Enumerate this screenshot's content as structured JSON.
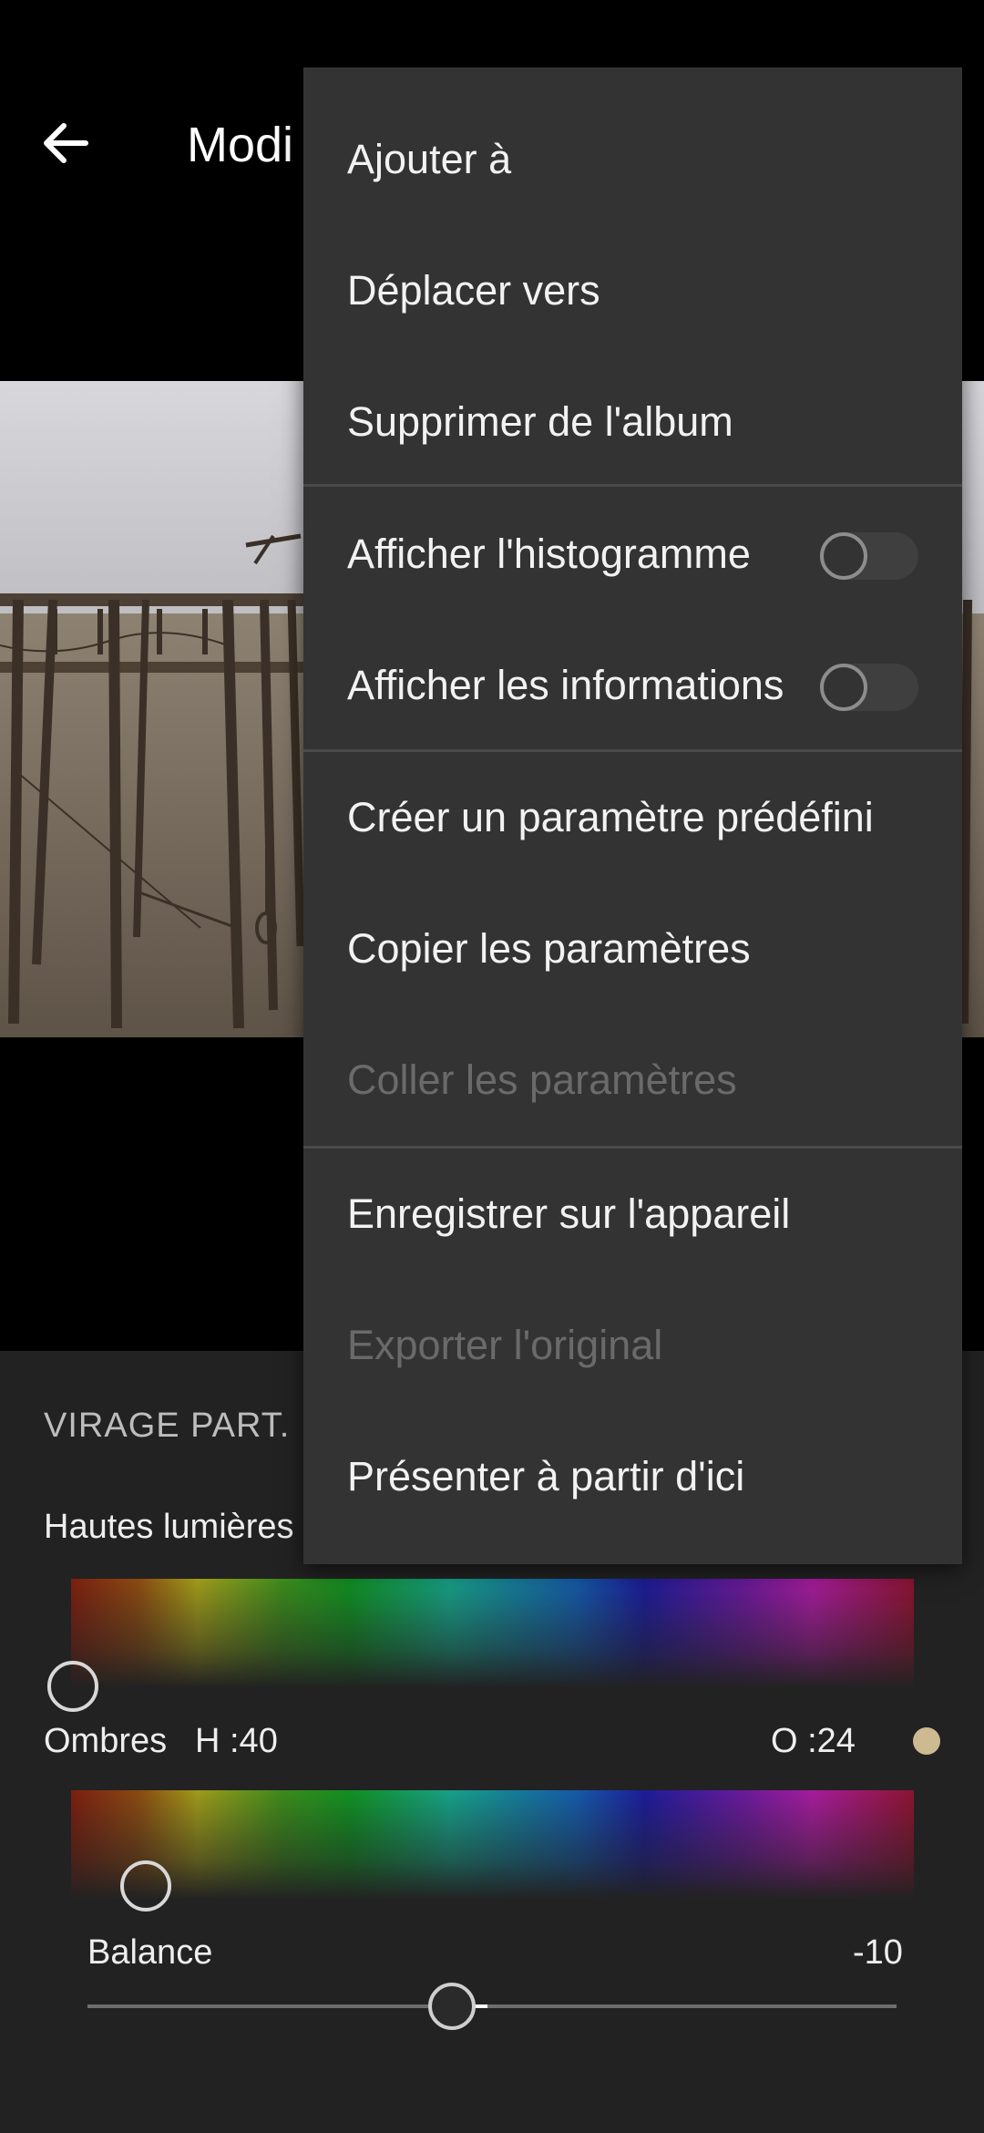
{
  "header": {
    "title": "Modi"
  },
  "panel": {
    "section_title": "VIRAGE PART.",
    "highlights_label": "Hautes lumières",
    "shadows_label": "Ombres",
    "shadows_hue": "H :40",
    "shadows_saturation": "O :24",
    "shadows_color": "#cdb992",
    "balance_label": "Balance",
    "balance_value": "-10"
  },
  "menu": {
    "items": [
      {
        "label": "Ajouter à",
        "enabled": true
      },
      {
        "label": "Déplacer vers",
        "enabled": true
      },
      {
        "label": "Supprimer de l'album",
        "enabled": true
      },
      {
        "label": "Afficher l'histogramme",
        "enabled": true,
        "toggle": false
      },
      {
        "label": "Afficher les informations",
        "enabled": true,
        "toggle": false
      },
      {
        "label": "Créer un paramètre prédéfini",
        "enabled": true
      },
      {
        "label": "Copier les paramètres",
        "enabled": true
      },
      {
        "label": "Coller les paramètres",
        "enabled": false
      },
      {
        "label": "Enregistrer sur l'appareil",
        "enabled": true
      },
      {
        "label": "Exporter l'original",
        "enabled": false
      },
      {
        "label": "Présenter à partir d'ici",
        "enabled": true
      }
    ]
  }
}
